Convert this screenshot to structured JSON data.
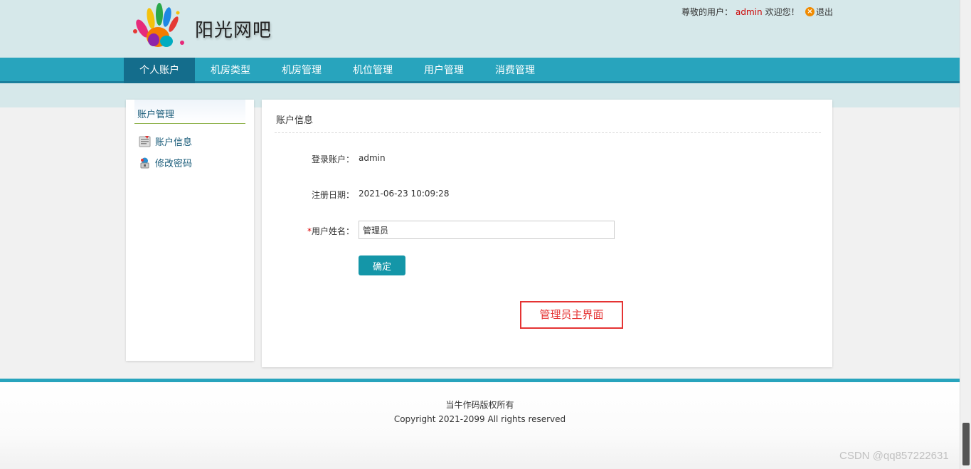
{
  "header": {
    "logo_text": "阳光网吧",
    "greeting_prefix": "尊敬的用户：",
    "username": "admin",
    "greeting_suffix": "欢迎您！",
    "logout_label": "退出"
  },
  "nav": {
    "items": [
      {
        "label": "个人账户"
      },
      {
        "label": "机房类型"
      },
      {
        "label": "机房管理"
      },
      {
        "label": "机位管理"
      },
      {
        "label": "用户管理"
      },
      {
        "label": "消费管理"
      }
    ]
  },
  "sidebar": {
    "title": "账户管理",
    "items": [
      {
        "label": "账户信息",
        "icon": "account-info-icon"
      },
      {
        "label": "修改密码",
        "icon": "change-password-icon"
      }
    ]
  },
  "main": {
    "title": "账户信息",
    "login_label": "登录账户：",
    "login_value": "admin",
    "reg_label": "注册日期：",
    "reg_value": "2021-06-23 10:09:28",
    "required_mark": "*",
    "name_label": "用户姓名：",
    "name_value": "管理员",
    "confirm_label": "确定",
    "annotation": "管理员主界面"
  },
  "footer": {
    "line1": "当牛作码版权所有",
    "line2": "Copyright 2021-2099 All rights reserved"
  },
  "watermark": "CSDN @qq857222631",
  "colors": {
    "nav_bg": "#28a4bd",
    "nav_active": "#146d8c",
    "accent_button": "#1496a8",
    "annotation_red": "#e53333",
    "username_red": "#cc0000"
  }
}
